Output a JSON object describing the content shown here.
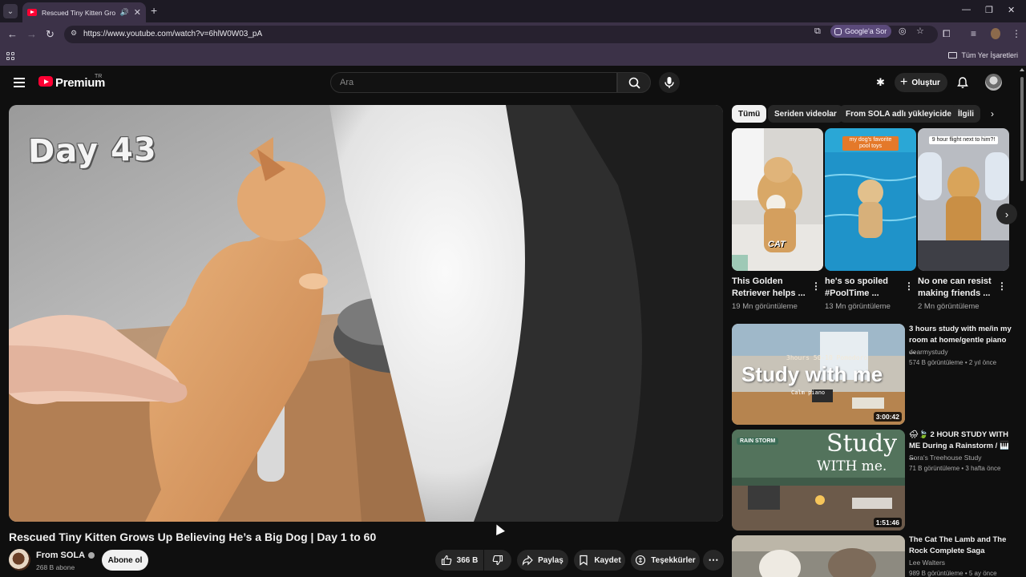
{
  "browser": {
    "tab_title": "Rescued Tiny Kitten Grows",
    "url": "https://www.youtube.com/watch?v=6hlW0W03_pA",
    "google_ask": "Google'a Sor",
    "all_bookmarks": "Tüm Yer İşaretleri"
  },
  "youtube": {
    "brand": "Premium",
    "brand_region": "TR",
    "search_placeholder": "Ara",
    "create_label": "Oluştur"
  },
  "video": {
    "overlay_text": "Day 43",
    "title": "Rescued Tiny Kitten Grows Up Believing He’s a Big Dog | Day 1 to 60",
    "channel": "From SOLA",
    "subscribers": "268 B abone",
    "subscribe_label": "Abone ol",
    "likes": "366 B",
    "share_label": "Paylaş",
    "save_label": "Kaydet",
    "thanks_label": "Teşekkürler"
  },
  "chips": [
    "Tümü",
    "Seriden videolar",
    "From SOLA adlı yükleyiciden",
    "İlgili"
  ],
  "shorts": [
    {
      "title_line1": "This Golden",
      "title_line2": "Retriever helps ...",
      "views": "19 Mn görüntüleme",
      "tag": "CAT"
    },
    {
      "title_line1": "he's so spoiled",
      "title_line2": "#PoolTime ...",
      "views": "13 Mn görüntüleme",
      "tag": "my dog's favorite pool toys"
    },
    {
      "title_line1": "No one can resist",
      "title_line2": "making friends ...",
      "views": "2 Mn görüntüleme",
      "tag": "9 hour flight next to him?!"
    }
  ],
  "recommendations": [
    {
      "title": "3 hours study with me/in my room at home/gentle piano ...",
      "channel": "dearmystudy",
      "meta": "574 B görüntüleme • 2 yıl önce",
      "duration": "3:00:42",
      "thumb_text": "Study with me",
      "thumb_sub": "3hours 50-10 Pomodoro",
      "thumb_sub2": "Calm piano"
    },
    {
      "title": "🌧🍃 2 HOUR STUDY WITH ME During a Rainstorm / 🎹 ...",
      "channel": "Sora's Treehouse Study",
      "meta": "71 B görüntüleme • 3 hafta önce",
      "duration": "1:51:46",
      "thumb_text": "Study",
      "thumb_text2": "WITH me.",
      "thumb_tag": "RAIN STORM"
    },
    {
      "title": "The Cat The Lamb and The Rock Complete Saga",
      "channel": "Lee Walters",
      "meta": "989 B görüntüleme • 5 ay önce"
    }
  ]
}
